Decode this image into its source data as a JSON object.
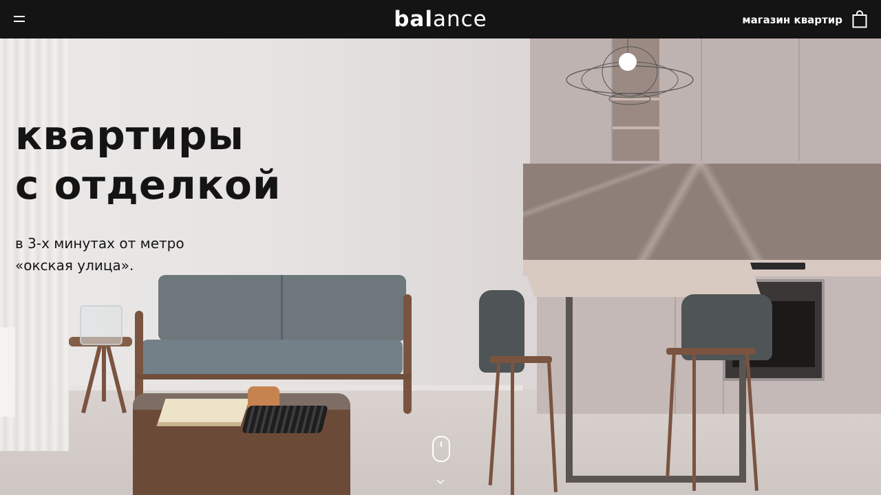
{
  "header": {
    "menu_icon": "hamburger-icon",
    "logo_bold": "bal",
    "logo_light": "ance",
    "shop_link": "магазин квартир",
    "bag_icon": "shopping-bag-icon"
  },
  "hero": {
    "title": "квартиры\nс отделкой",
    "subtitle": "в 3-х минутах от метро\n«окская улица».",
    "scroll_icon": "mouse-scroll-icon",
    "scroll_chevron_icon": "chevron-down-icon"
  },
  "colors": {
    "header_bg": "#141414",
    "header_text": "#ffffff",
    "hero_text": "#141414"
  }
}
